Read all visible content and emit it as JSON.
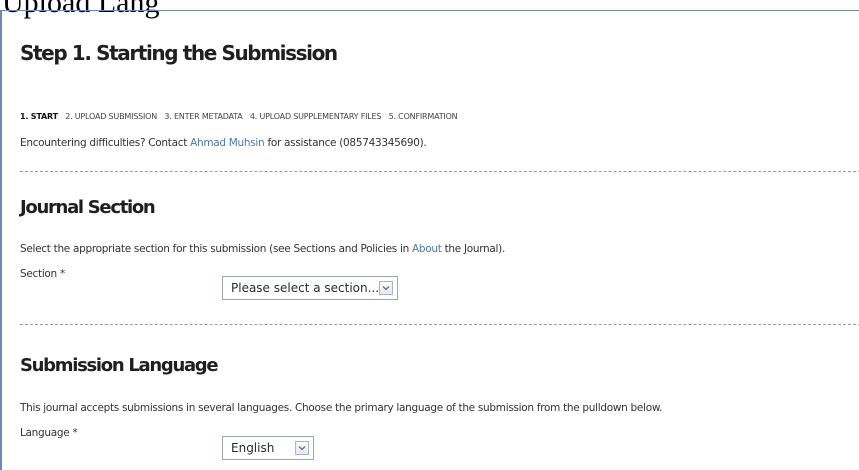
{
  "caption_fragment": "Upload Lang",
  "form": {
    "title": "Step 1. Starting the Submission",
    "steps": [
      "1. START",
      "2. UPLOAD SUBMISSION",
      "3. ENTER METADATA",
      "4. UPLOAD SUPPLEMENTARY FILES",
      "5. CONFIRMATION"
    ],
    "help": {
      "prefix": "Encountering difficulties? Contact ",
      "contact_name": "Ahmad Muhsin",
      "suffix": " for assistance (085743345690)."
    },
    "journal_section": {
      "heading": "Journal Section",
      "desc_prefix": "Select the appropriate section for this submission (see Sections and Policies in ",
      "desc_link": "About",
      "desc_suffix": " the Journal).",
      "field_label": "Section *",
      "selected_value": "Please select a section..."
    },
    "submission_language": {
      "heading": "Submission Language",
      "desc": "This journal accepts submissions in several languages. Choose the primary language of the submission from the pulldown below.",
      "field_label": "Language *",
      "selected_value": "English"
    }
  },
  "icons": {
    "dropdown": "chevron-down-icon"
  },
  "colors": {
    "link": "#4a78b8",
    "panel_border": "#6f86b8",
    "divider": "#9a9a9a"
  }
}
